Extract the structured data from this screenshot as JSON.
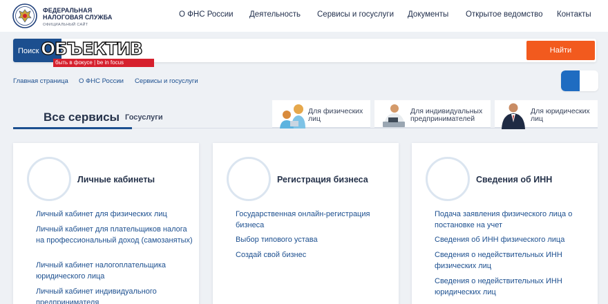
{
  "header": {
    "logo_line1": "ФЕДЕРАЛЬНАЯ",
    "logo_line2": "НАЛОГОВАЯ СЛУЖБА",
    "logo_line3": "ОФИЦИАЛЬНЫЙ САЙТ",
    "nav": [
      "О ФНС России",
      "Деятельность",
      "Сервисы и госуслуги",
      "Документы",
      "Открытое ведомство",
      "Контакты"
    ]
  },
  "search": {
    "label": "Поиск",
    "value": "",
    "button_label": "Найти"
  },
  "watermark": {
    "title": "ОБЪЕКТИВ",
    "tagline": "быть в фокусе | be in focus"
  },
  "breadcrumb": [
    "Главная страница",
    "О ФНС России",
    "Сервисы и госуслуги"
  ],
  "tabs": {
    "active": "Все сервисы",
    "other": "Госуслуги"
  },
  "audiences": [
    {
      "label": "Для физических лиц"
    },
    {
      "label": "Для индивидуальных предпринимателей"
    },
    {
      "label": "Для юридических лиц"
    }
  ],
  "cards": [
    {
      "title": "Личные кабинеты",
      "links": [
        "Личный кабинет для физических лиц",
        "Личный кабинет для плательщиков налога на профессиональный доход (самозанятых)",
        "Личный кабинет налогоплательщика юридического лица",
        "Личный кабинет индивидуального предпринимателя"
      ]
    },
    {
      "title": "Регистрация бизнеса",
      "links": [
        "Государственная онлайн-регистрация бизнеса",
        "Выбор типового устава",
        "Создай свой бизнес"
      ]
    },
    {
      "title": "Сведения об ИНН",
      "links": [
        "Подача заявления физического лица о постановке на учет",
        "Сведения об ИНН физического лица",
        "Сведения о недействительных ИНН физических лиц",
        "Сведения о недействительных ИНН юридических лиц"
      ]
    }
  ],
  "colors": {
    "primary": "#1c4f8f",
    "accent": "#f25a1e",
    "background": "#eef1f5"
  }
}
